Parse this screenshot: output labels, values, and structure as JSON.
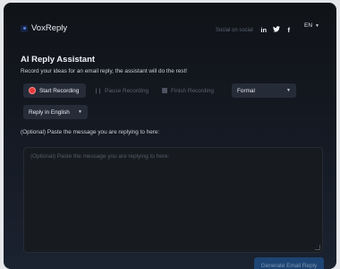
{
  "header": {
    "brand": "VoxReply",
    "social_label": "Social on social",
    "social_icons": [
      "linkedin-icon",
      "twitter-icon",
      "facebook-icon"
    ],
    "language": "EN"
  },
  "main": {
    "title": "AI Reply Assistant",
    "subtitle": "Record your ideas for an email reply, the assistant will do the rest!",
    "controls": {
      "start_label": "Start Recording",
      "pause_label": "Pause Recording",
      "finish_label": "Finish Recording",
      "tone_value": "Formal",
      "reply_language_value": "Reply in English"
    },
    "paste_label": "(Optional) Paste the message you are replying to here:",
    "textarea_placeholder": "(Optional) Paste the message you are replying to here:",
    "generate_label": "Generate Email Reply"
  },
  "colors": {
    "record": "#e53a3a",
    "primary_button": "#1d4473"
  }
}
